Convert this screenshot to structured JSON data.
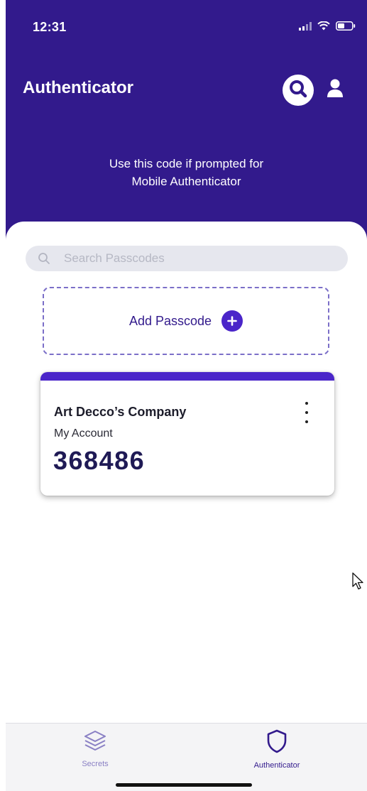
{
  "status_bar": {
    "time": "12:31"
  },
  "header": {
    "title": "Authenticator",
    "search_icon": "search-icon",
    "user_icon": "user-icon",
    "prompt_line1": "Use this code if prompted for",
    "prompt_line2": "Mobile Authenticator",
    "background_color": "#321a8c"
  },
  "search": {
    "placeholder": "Search Passcodes",
    "value": ""
  },
  "add_passcode": {
    "label": "Add Passcode",
    "icon": "plus-circle-icon"
  },
  "passcodes": [
    {
      "company": "Art Decco’s Company",
      "account": "My Account",
      "code": "368486",
      "accent_color": "#4a25c9"
    }
  ],
  "tab_bar": {
    "tabs": [
      {
        "label": "Secrets",
        "icon": "layers-icon",
        "active": false
      },
      {
        "label": "Authenticator",
        "icon": "shield-icon",
        "active": true
      }
    ]
  },
  "colors": {
    "primary": "#321a8c",
    "accent": "#4a25c9",
    "search_bg": "#e6e7ee"
  }
}
